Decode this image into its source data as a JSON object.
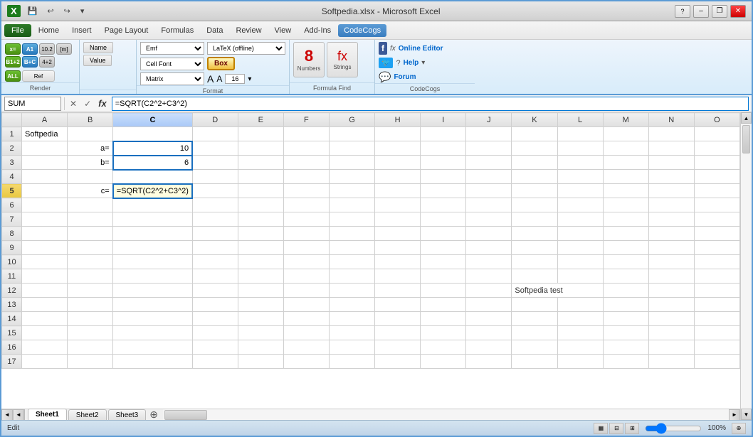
{
  "window": {
    "title": "Softpedia.xlsx - Microsoft Excel",
    "titlebar_left": "Softpedia.xlsx - Microsoft Excel"
  },
  "titlebar": {
    "quicksave": "💾",
    "undo": "↩",
    "redo": "↪",
    "more": "▾",
    "minimize": "–",
    "restore": "❐",
    "close": "✕"
  },
  "menubar": {
    "file": "File",
    "home": "Home",
    "insert": "Insert",
    "pagelayout": "Page Layout",
    "formulas": "Formulas",
    "data": "Data",
    "review": "Review",
    "view": "View",
    "addins": "Add-Ins",
    "codecogs": "CodeCogs"
  },
  "ribbon": {
    "render_label": "Render",
    "format_label": "Format",
    "formula_find_label": "Formula Find",
    "emf_option": "Emf",
    "latex_offline": "LaTeX (offline)",
    "cell_font": "Cell Font",
    "matrix_label": "Matrix",
    "box_label": "Box",
    "font_size": "16",
    "numbers_label": "Numbers",
    "strings_label": "Strings",
    "codecogs_label": "CodeCogs",
    "online_editor": "Online Editor",
    "help_label": "Help",
    "forum_label": "Forum",
    "render_x_label": "x=",
    "render_a1": "A1",
    "render_b1plus2": "B1+2",
    "render_b_plus_c": "B+C",
    "render_4plus2": "4+2",
    "ref_label": "Ref",
    "name_label": "Name",
    "value_label": "Value",
    "num_10": "10.2",
    "num_m": "[m]"
  },
  "formulabar": {
    "namebox": "SUM",
    "cancel": "✕",
    "confirm": "✓",
    "fx": "fx",
    "formula": "=SQRT(C2^2+C3^2)"
  },
  "sheet": {
    "columns": [
      "",
      "A",
      "B",
      "C",
      "D",
      "E",
      "F",
      "G",
      "H",
      "I",
      "J",
      "K",
      "L",
      "M",
      "N",
      "O"
    ],
    "rows": [
      {
        "num": "1",
        "cells": [
          "Softpedia",
          "",
          "",
          "",
          "",
          "",
          "",
          "",
          "",
          "",
          "",
          "",
          "",
          "",
          ""
        ]
      },
      {
        "num": "2",
        "cells": [
          "",
          "a=",
          "",
          "10",
          "",
          "",
          "",
          "",
          "",
          "",
          "",
          "",
          "",
          "",
          ""
        ]
      },
      {
        "num": "3",
        "cells": [
          "",
          "b=",
          "",
          "6",
          "",
          "",
          "",
          "",
          "",
          "",
          "",
          "",
          "",
          "",
          ""
        ]
      },
      {
        "num": "4",
        "cells": [
          "",
          "",
          "",
          "",
          "",
          "",
          "",
          "",
          "",
          "",
          "",
          "",
          "",
          "",
          ""
        ]
      },
      {
        "num": "5",
        "cells": [
          "",
          "c=",
          "",
          "=SQRT(C2^2+C3^2)",
          "",
          "",
          "",
          "",
          "",
          "",
          "",
          "",
          "",
          "",
          ""
        ]
      },
      {
        "num": "6",
        "cells": [
          "",
          "",
          "",
          "",
          "",
          "",
          "",
          "",
          "",
          "",
          "",
          "",
          "",
          "",
          ""
        ]
      },
      {
        "num": "7",
        "cells": [
          "",
          "",
          "",
          "",
          "",
          "",
          "",
          "",
          "",
          "",
          "",
          "",
          "",
          "",
          ""
        ]
      },
      {
        "num": "8",
        "cells": [
          "",
          "",
          "",
          "",
          "",
          "",
          "",
          "",
          "",
          "",
          "",
          "",
          "",
          "",
          ""
        ]
      },
      {
        "num": "9",
        "cells": [
          "",
          "",
          "",
          "",
          "",
          "",
          "",
          "",
          "",
          "",
          "",
          "",
          "",
          "",
          ""
        ]
      },
      {
        "num": "10",
        "cells": [
          "",
          "",
          "",
          "",
          "",
          "",
          "",
          "",
          "",
          "",
          "",
          "",
          "",
          "",
          ""
        ]
      },
      {
        "num": "11",
        "cells": [
          "",
          "",
          "",
          "",
          "",
          "",
          "",
          "",
          "",
          "",
          "",
          "",
          "",
          "",
          ""
        ]
      },
      {
        "num": "12",
        "cells": [
          "",
          "",
          "",
          "",
          "",
          "",
          "",
          "",
          "",
          "",
          "Softpedia test",
          "",
          "",
          "",
          ""
        ]
      },
      {
        "num": "13",
        "cells": [
          "",
          "",
          "",
          "",
          "",
          "",
          "",
          "",
          "",
          "",
          "",
          "",
          "",
          "",
          ""
        ]
      },
      {
        "num": "14",
        "cells": [
          "",
          "",
          "",
          "",
          "",
          "",
          "",
          "",
          "",
          "",
          "",
          "",
          "",
          "",
          ""
        ]
      },
      {
        "num": "15",
        "cells": [
          "",
          "",
          "",
          "",
          "",
          "",
          "",
          "",
          "",
          "",
          "",
          "",
          "",
          "",
          ""
        ]
      },
      {
        "num": "16",
        "cells": [
          "",
          "",
          "",
          "",
          "",
          "",
          "",
          "",
          "",
          "",
          "",
          "",
          "",
          "",
          ""
        ]
      },
      {
        "num": "17",
        "cells": [
          "",
          "",
          "",
          "",
          "",
          "",
          "",
          "",
          "",
          "",
          "",
          "",
          "",
          "",
          ""
        ]
      }
    ],
    "active_cell": "C5",
    "selected_col": "C"
  },
  "tabs": {
    "sheet1": "Sheet1",
    "sheet2": "Sheet2",
    "sheet3": "Sheet3"
  },
  "statusbar": {
    "mode": "Edit",
    "zoom": "100%"
  }
}
